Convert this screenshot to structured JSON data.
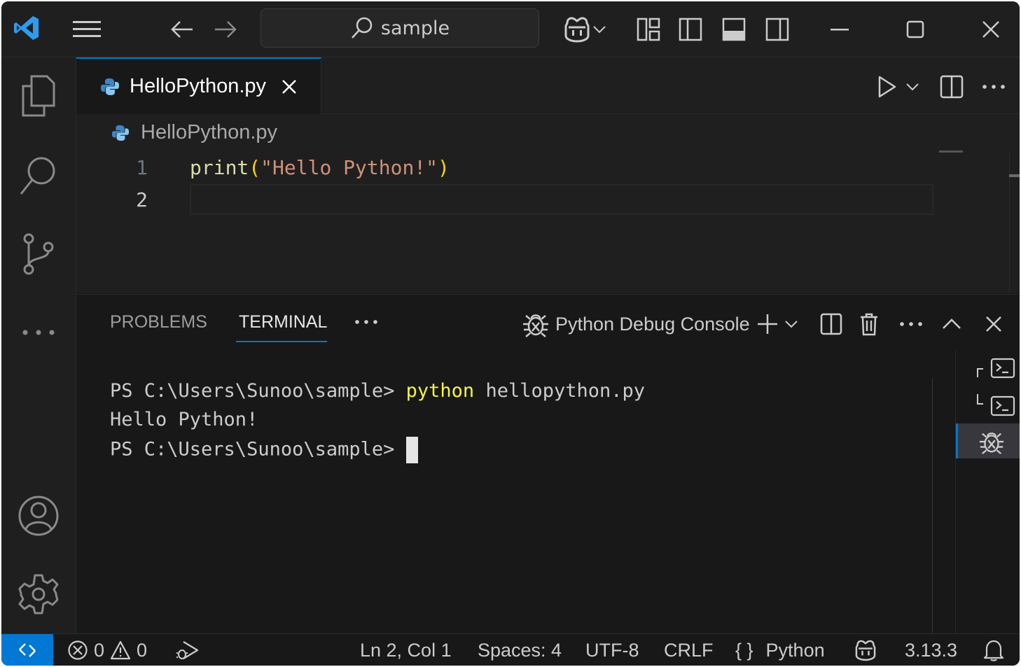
{
  "titlebar": {
    "search_text": "sample"
  },
  "tab": {
    "label": "HelloPython.py"
  },
  "breadcrumb": {
    "file": "HelloPython.py"
  },
  "editor": {
    "lines": [
      {
        "number": "1",
        "code_fn": "print",
        "code_open": "(",
        "code_str": "\"Hello Python!\"",
        "code_close": ")"
      },
      {
        "number": "2"
      }
    ]
  },
  "panel": {
    "tabs": [
      {
        "label": "PROBLEMS",
        "active": false
      },
      {
        "label": "TERMINAL",
        "active": true
      }
    ],
    "terminal_name": "Python Debug Console",
    "terminal": {
      "line1_prompt": "PS C:\\Users\\Sunoo\\sample> ",
      "line1_cmd": "python",
      "line1_args": " hellopython.py",
      "line2": "Hello Python!",
      "line3_prompt": "PS C:\\Users\\Sunoo\\sample> "
    }
  },
  "statusbar": {
    "errors": "0",
    "warnings": "0",
    "position": "Ln 2, Col 1",
    "spaces": "Spaces: 4",
    "encoding": "UTF-8",
    "eol": "CRLF",
    "language_braces": "{ }",
    "language": "Python",
    "interpreter_version": "3.13.3"
  },
  "colors": {
    "accent": "#0078d4",
    "keyword_fn": "#dcdcaa",
    "string": "#ce9178",
    "bracket": "#ffd700",
    "terminal_cmd": "#f5f543"
  }
}
